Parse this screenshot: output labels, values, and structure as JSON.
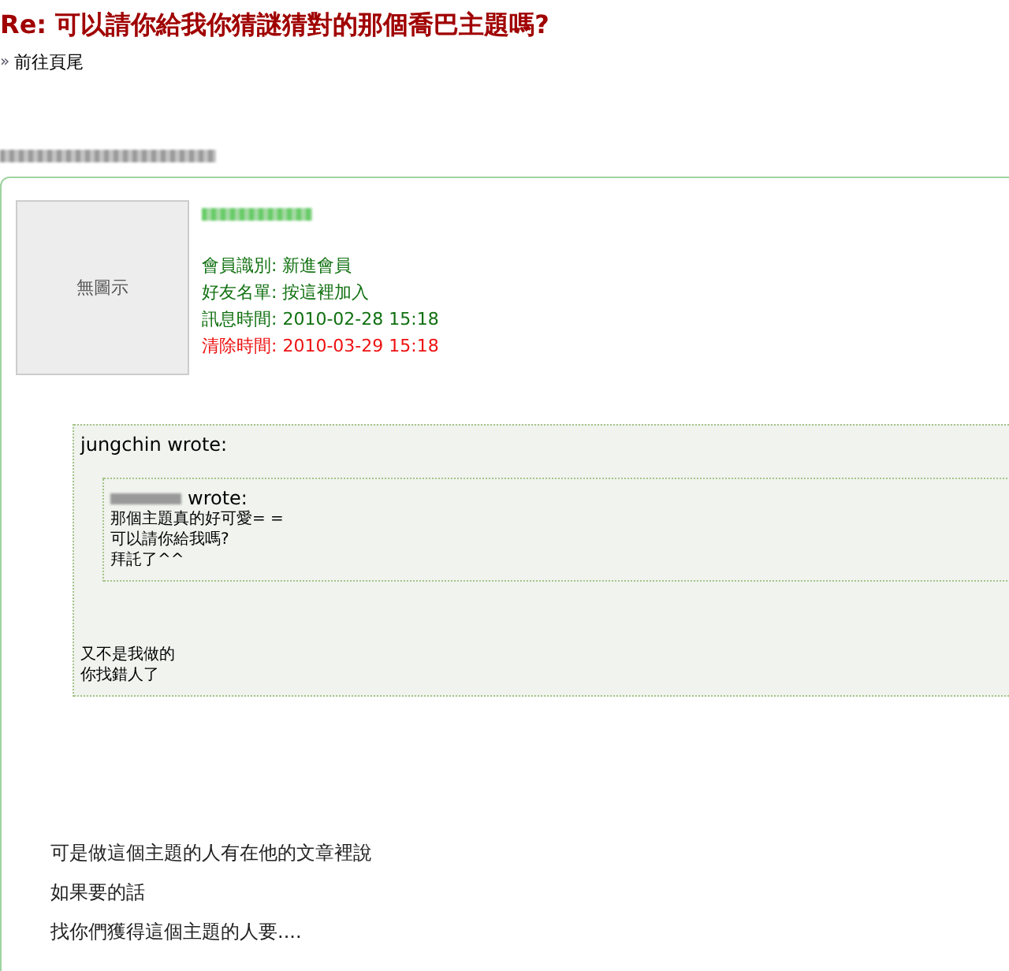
{
  "page_title": "Re: 可以請你給我你猜謎猜對的那個喬巴主題嗎?",
  "nav_link": {
    "marker": "»",
    "label": "前往頁尾"
  },
  "post": {
    "avatar_caption": "無圖示",
    "info": [
      {
        "label": "會員識別:",
        "value": "新進會員",
        "color": "#107010"
      },
      {
        "label": "好友名單:",
        "value": "按這裡加入",
        "color": "#107010"
      },
      {
        "label": "訊息時間:",
        "value": "2010-02-28 15:18",
        "color": "#107010"
      },
      {
        "label": "清除時間:",
        "value": "2010-03-29 15:18",
        "color": "#ee1111"
      }
    ],
    "quote": {
      "author_line": "jungchin wrote:",
      "nested_quote": {
        "author_suffix": "wrote:",
        "lines": [
          "那個主題真的好可愛= =",
          "可以請你給我嗎?",
          "拜託了^^"
        ]
      },
      "lines": [
        "又不是我做的",
        "你找錯人了"
      ]
    },
    "body": [
      "可是做這個主題的人有在他的文章裡說",
      "如果要的話",
      "找你們獲得這個主題的人要...."
    ]
  }
}
